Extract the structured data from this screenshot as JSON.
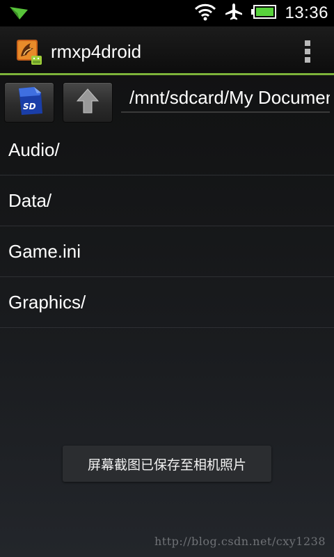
{
  "status_bar": {
    "time": "13:36",
    "icons": [
      "notification-arrow-icon",
      "wifi-icon",
      "airplane-icon",
      "battery-icon"
    ],
    "battery_color": "#58d23c"
  },
  "action_bar": {
    "app_title": "rmxp4droid",
    "app_icon": "dragon-app-icon",
    "accent_color": "#7db33a"
  },
  "toolbar": {
    "sd_button_icon": "sd-card-icon",
    "up_button_icon": "up-arrow-icon",
    "path_value": "/mnt/sdcard/My Documents"
  },
  "file_list": {
    "items": [
      {
        "name": "Audio/"
      },
      {
        "name": "Data/"
      },
      {
        "name": "Game.ini"
      },
      {
        "name": "Graphics/"
      }
    ]
  },
  "toast": {
    "message": "屏幕截图已保存至相机照片"
  },
  "watermark": {
    "text": "http://blog.csdn.net/cxy1238"
  }
}
